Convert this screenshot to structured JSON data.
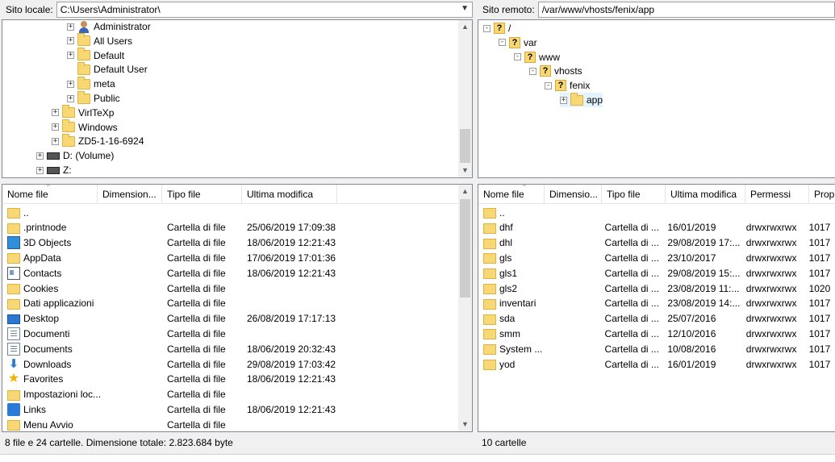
{
  "local_site": {
    "label": "Sito locale:",
    "path": "C:\\Users\\Administrator\\",
    "tree": [
      {
        "label": "Administrator",
        "icon": "user-icon",
        "exp": "+"
      },
      {
        "label": "All Users",
        "icon": "folder-icon",
        "exp": "+"
      },
      {
        "label": "Default",
        "icon": "folder-icon",
        "exp": "+"
      },
      {
        "label": "Default User",
        "icon": "folder-icon",
        "exp": ""
      },
      {
        "label": "meta",
        "icon": "folder-icon",
        "exp": "+"
      },
      {
        "label": "Public",
        "icon": "folder-icon",
        "exp": "+"
      },
      {
        "label": "VirlTeXp",
        "icon": "folder-icon",
        "exp": "+"
      },
      {
        "label": "Windows",
        "icon": "folder-icon",
        "exp": "+"
      },
      {
        "label": "ZD5-1-16-6924",
        "icon": "folder-icon",
        "exp": "+"
      },
      {
        "label": "D: (Volume)",
        "icon": "drive-icon",
        "exp": "+"
      },
      {
        "label": "Z:",
        "icon": "network-drive-icon",
        "exp": "+"
      }
    ],
    "columns": [
      "Nome file",
      "Dimension...",
      "Tipo file",
      "Ultima modifica"
    ],
    "files": [
      {
        "name": "..",
        "type": "",
        "modified": "",
        "icon": "folder-icon"
      },
      {
        "name": ".printnode",
        "type": "Cartella di file",
        "modified": "25/06/2019 17:09:38",
        "icon": "folder-icon"
      },
      {
        "name": "3D Objects",
        "type": "Cartella di file",
        "modified": "18/06/2019 12:21:43",
        "icon": "3d-objects-icon"
      },
      {
        "name": "AppData",
        "type": "Cartella di file",
        "modified": "17/06/2019 17:01:36",
        "icon": "folder-icon"
      },
      {
        "name": "Contacts",
        "type": "Cartella di file",
        "modified": "18/06/2019 12:21:43",
        "icon": "contacts-icon"
      },
      {
        "name": "Cookies",
        "type": "Cartella di file",
        "modified": "",
        "icon": "folder-icon"
      },
      {
        "name": "Dati applicazioni",
        "type": "Cartella di file",
        "modified": "",
        "icon": "folder-icon"
      },
      {
        "name": "Desktop",
        "type": "Cartella di file",
        "modified": "26/08/2019 17:17:13",
        "icon": "desktop-icon"
      },
      {
        "name": "Documenti",
        "type": "Cartella di file",
        "modified": "",
        "icon": "document-icon"
      },
      {
        "name": "Documents",
        "type": "Cartella di file",
        "modified": "18/06/2019 20:32:43",
        "icon": "document-icon"
      },
      {
        "name": "Downloads",
        "type": "Cartella di file",
        "modified": "29/08/2019 17:03:42",
        "icon": "download-icon"
      },
      {
        "name": "Favorites",
        "type": "Cartella di file",
        "modified": "18/06/2019 12:21:43",
        "icon": "star-icon"
      },
      {
        "name": "Impostazioni loc...",
        "type": "Cartella di file",
        "modified": "",
        "icon": "folder-icon"
      },
      {
        "name": "Links",
        "type": "Cartella di file",
        "modified": "18/06/2019 12:21:43",
        "icon": "link-icon"
      },
      {
        "name": "Menu Avvio",
        "type": "Cartella di file",
        "modified": "",
        "icon": "folder-icon"
      }
    ],
    "status": "8 file e 24 cartelle. Dimensione totale: 2.823.684 byte"
  },
  "remote_site": {
    "label": "Sito remoto:",
    "path": "/var/www/vhosts/fenix/app",
    "tree": [
      {
        "label": "/",
        "exp": "-"
      },
      {
        "label": "var",
        "exp": "-"
      },
      {
        "label": "www",
        "exp": "-"
      },
      {
        "label": "vhosts",
        "exp": "-"
      },
      {
        "label": "fenix",
        "exp": "-"
      },
      {
        "label": "app",
        "exp": "+"
      }
    ],
    "columns": [
      "Nome file",
      "Dimensio...",
      "Tipo file",
      "Ultima modifica",
      "Permessi",
      "Propri"
    ],
    "files": [
      {
        "name": "..",
        "type": "",
        "modified": "",
        "perms": "",
        "owner": ""
      },
      {
        "name": "dhf",
        "type": "Cartella di ...",
        "modified": "16/01/2019",
        "perms": "drwxrwxrwx",
        "owner": "1017"
      },
      {
        "name": "dhl",
        "type": "Cartella di ...",
        "modified": "29/08/2019 17:...",
        "perms": "drwxrwxrwx",
        "owner": "1017"
      },
      {
        "name": "gls",
        "type": "Cartella di ...",
        "modified": "23/10/2017",
        "perms": "drwxrwxrwx",
        "owner": "1017"
      },
      {
        "name": "gls1",
        "type": "Cartella di ...",
        "modified": "29/08/2019 15:...",
        "perms": "drwxrwxrwx",
        "owner": "1017"
      },
      {
        "name": "gls2",
        "type": "Cartella di ...",
        "modified": "23/08/2019 11:...",
        "perms": "drwxrwxrwx",
        "owner": "1020"
      },
      {
        "name": "inventari",
        "type": "Cartella di ...",
        "modified": "23/08/2019 14:...",
        "perms": "drwxrwxrwx",
        "owner": "1017"
      },
      {
        "name": "sda",
        "type": "Cartella di ...",
        "modified": "25/07/2016",
        "perms": "drwxrwxrwx",
        "owner": "1017"
      },
      {
        "name": "smm",
        "type": "Cartella di ...",
        "modified": "12/10/2016",
        "perms": "drwxrwxrwx",
        "owner": "1017"
      },
      {
        "name": "System ...",
        "type": "Cartella di ...",
        "modified": "10/08/2016",
        "perms": "drwxrwxrwx",
        "owner": "1017"
      },
      {
        "name": "yod",
        "type": "Cartella di ...",
        "modified": "16/01/2019",
        "perms": "drwxrwxrwx",
        "owner": "1017"
      }
    ],
    "status": "10 cartelle"
  },
  "icons": {
    "expand": "plus-box-icon",
    "collapse": "minus-box-icon",
    "unknown_folder": "question-folder-icon",
    "dropdown": "chevron-down-icon",
    "scroll_up": "arrow-up-icon",
    "scroll_down": "arrow-down-icon"
  },
  "colors": {
    "folder": "#f8d775",
    "selection": "#e5f3ff",
    "chrome": "#f0f0f0"
  }
}
